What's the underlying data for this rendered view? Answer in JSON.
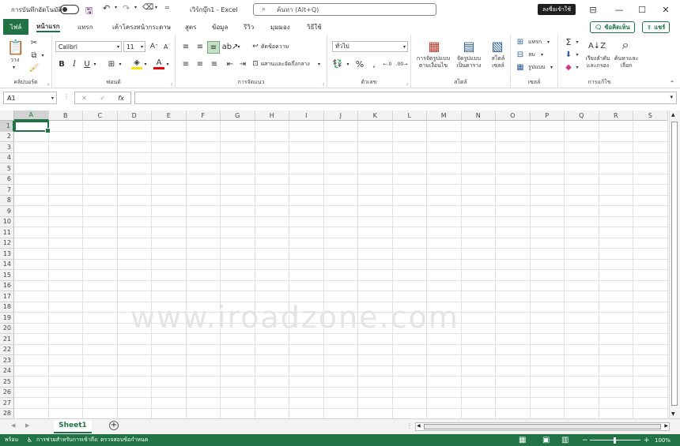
{
  "titlebar": {
    "autosave_label": "การบันทึกอัตโนมัติ",
    "autosave_state": "off",
    "app_title": "เวิร์กบุ๊ก1 - Excel",
    "search_placeholder": "ค้นหา (Alt+Q)",
    "signin_label": "ลงชื่อเข้าใช้",
    "qat_more": "="
  },
  "tabs": {
    "file": "ไฟล์",
    "items": [
      "หน้าแรก",
      "แทรก",
      "เค้าโครงหน้ากระดาษ",
      "สูตร",
      "ข้อมูล",
      "รีวิว",
      "มุมมอง",
      "วิธีใช้"
    ],
    "active": "หน้าแรก",
    "comments_btn": "ข้อคิดเห็น",
    "share_btn": "แชร์"
  },
  "ribbon": {
    "clipboard": {
      "label": "คลิปบอร์ด",
      "paste": "วาง"
    },
    "font": {
      "label": "ฟอนต์",
      "font_name": "Calibri",
      "font_size": "11"
    },
    "alignment": {
      "label": "การจัดแนว",
      "wrap_text": "ตัดข้อความ",
      "merge_center": "ผสานและจัดกึ่งกลาง"
    },
    "number": {
      "label": "ตัวเลข",
      "format": "ทั่วไป"
    },
    "styles": {
      "label": "สไตล์",
      "conditional_line1": "การจัดรูปแบบ",
      "conditional_line2": "ตามเงื่อนไข",
      "table_line1": "จัดรูปแบบ",
      "table_line2": "เป็นตาราง",
      "cell_line1": "สไตล์",
      "cell_line2": "เซลล์"
    },
    "cells": {
      "label": "เซลล์",
      "insert": "แทรก",
      "delete": "ลบ",
      "format": "รูปแบบ"
    },
    "editing": {
      "label": "การแก้ไข",
      "sort_line1": "เรียงลำดับ",
      "sort_line2": "และกรอง",
      "find_line1": "ค้นหาและ",
      "find_line2": "เลือก"
    }
  },
  "formula_bar": {
    "name_box": "A1",
    "fx": "fx",
    "cancel": "✕",
    "enter": "✓"
  },
  "sheet": {
    "columns": [
      "A",
      "B",
      "C",
      "D",
      "E",
      "F",
      "G",
      "H",
      "I",
      "J",
      "K",
      "L",
      "M",
      "N",
      "O",
      "P",
      "Q",
      "R",
      "S"
    ],
    "rows": [
      "1",
      "2",
      "3",
      "4",
      "5",
      "6",
      "7",
      "8",
      "9",
      "10",
      "11",
      "12",
      "13",
      "14",
      "15",
      "16",
      "17",
      "18",
      "19",
      "20",
      "21",
      "22",
      "23",
      "24",
      "25",
      "26",
      "27",
      "28"
    ],
    "selected_cell": "A1",
    "watermark": "www.iroadzone.com"
  },
  "sheet_tabs": {
    "active": "Sheet1",
    "add": "+"
  },
  "status": {
    "ready": "พร้อม",
    "accessibility": "การช่วยสำหรับการเข้าถึง: ตรวจสอบข้อกำหนด",
    "zoom": "100%"
  }
}
